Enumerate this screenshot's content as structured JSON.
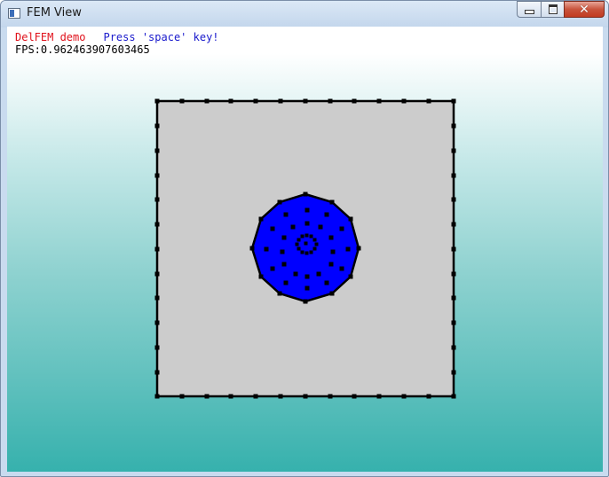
{
  "window": {
    "title": "FEM View",
    "icons": {
      "app": "window-icon",
      "minimize": "minimize-icon",
      "maximize": "maximize-icon",
      "close": "close-icon"
    }
  },
  "overlay": {
    "demo_label": "DelFEM demo",
    "instruction": "Press 'space' key!",
    "fps": "FPS:0.962463907603465"
  },
  "colors": {
    "demo_text": "#e0101a",
    "instruction_text": "#1a1acc",
    "domain_fill": "#cccccc",
    "inclusion_fill": "#0000ff",
    "close_button": "#c8543c",
    "background_bottom": "#36b1ad"
  }
}
